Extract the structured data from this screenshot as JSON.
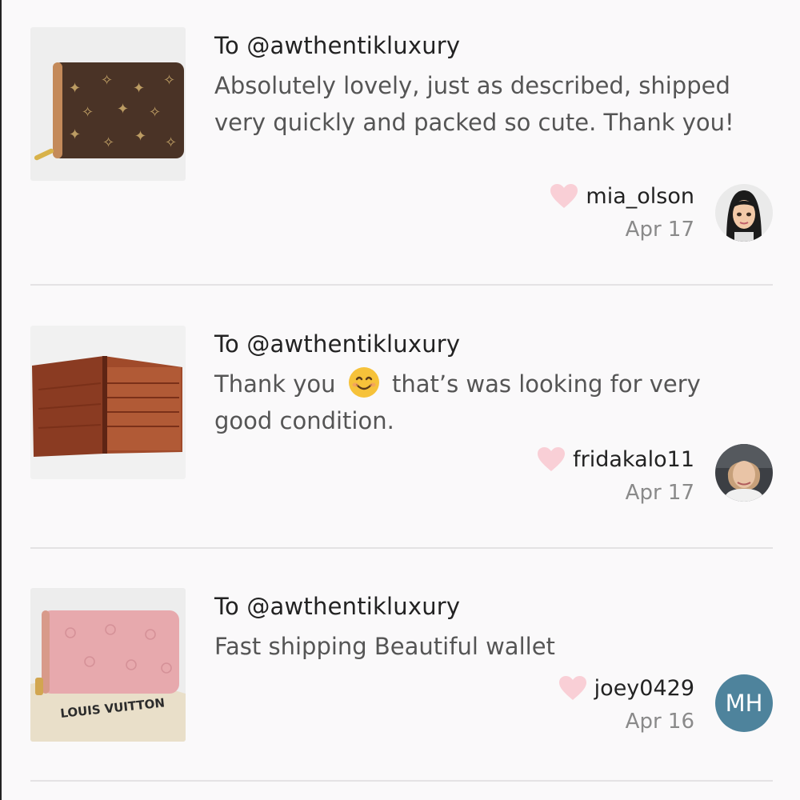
{
  "reviews": [
    {
      "to": "To @awthentikluxury",
      "text": "Absolutely lovely, just as described, shipped very quickly and packed so cute. Thank you!",
      "username": "mia_olson",
      "date": "Apr 17",
      "avatar_icon": "cartoon-doll-avatar"
    },
    {
      "to": "To @awthentikluxury",
      "text_before": "Thank you",
      "emoji": "smiling-face-emoji",
      "text_after": "that’s was looking for very good condition.",
      "username": "fridakalo11",
      "date": "Apr 17",
      "avatar_icon": "person-photo-avatar"
    },
    {
      "to": "To @awthentikluxury",
      "text": "Fast shipping Beautiful wallet",
      "username": "joey0429",
      "date": "Apr 16",
      "avatar_initials": "MH"
    }
  ],
  "thumb3_brand": "LOUIS VUITTON",
  "colors": {
    "heart": "#f9cfd6",
    "avatar_initials_bg": "#4e839c",
    "divider": "#e4e2e4",
    "background": "#faf9fa"
  }
}
